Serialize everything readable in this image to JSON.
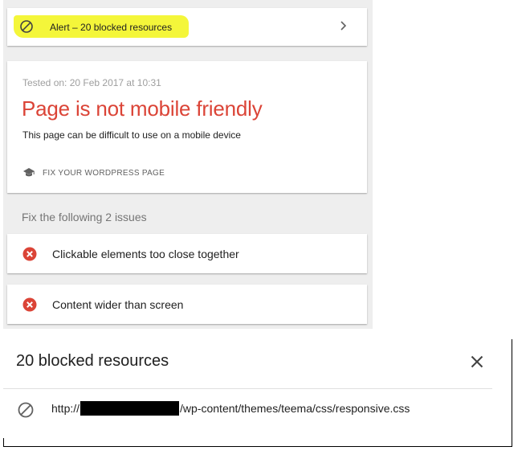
{
  "alert": {
    "text": "Alert – 20 blocked resources",
    "icon": "blocked-icon",
    "highlight_color": "#f4f63a"
  },
  "result": {
    "tested_on": "Tested on: 20 Feb 2017 at 10:31",
    "title": "Page is not mobile friendly",
    "subtitle": "This page can be difficult to use on a mobile device",
    "fix_link": "FIX YOUR WORDPRESS PAGE",
    "title_color": "#db4437"
  },
  "issues": {
    "heading": "Fix the following 2 issues",
    "items": [
      {
        "label": "Clickable elements too close together",
        "icon": "error-icon"
      },
      {
        "label": "Content wider than screen",
        "icon": "error-icon"
      }
    ]
  },
  "dialog": {
    "title": "20 blocked resources",
    "resources": [
      {
        "url_prefix": "http://",
        "url_suffix": "/wp-content/themes/teema/css/responsive.css",
        "redacted": true
      }
    ]
  }
}
